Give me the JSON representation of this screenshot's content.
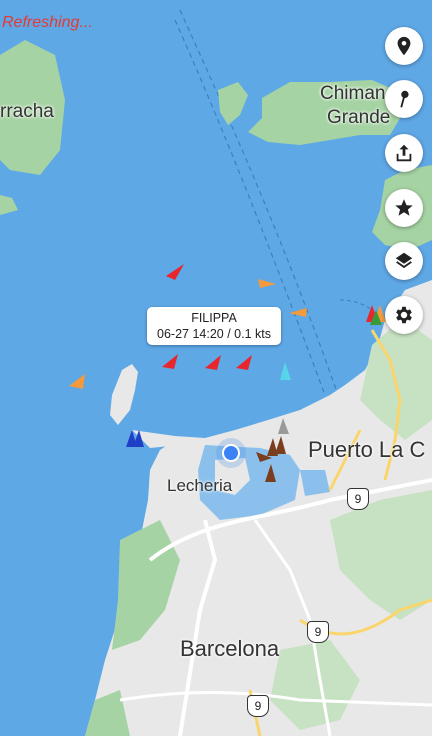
{
  "status": {
    "refreshing": "Refreshing..."
  },
  "map_labels": {
    "rracha": "rracha",
    "chiman": "Chiman",
    "grande": "Grande",
    "puerto": "Puerto La C",
    "lecheria": "Lecheria",
    "barcelona": "Barcelona"
  },
  "road_shields": [
    "9",
    "9",
    "9"
  ],
  "vessel_callout": {
    "name": "FILIPPA",
    "info": "06-27 14:20 / 0.1 kts"
  },
  "buttons": [
    "location-pin-icon",
    "drop-pin-icon",
    "share-icon",
    "star-icon",
    "layers-icon",
    "settings-icon"
  ],
  "colors": {
    "water": "#5fa8e6",
    "land": "#e8e8e8",
    "green": "#a6d3a4",
    "vessel_red": "#e8262e",
    "vessel_orange": "#f39a3c"
  }
}
